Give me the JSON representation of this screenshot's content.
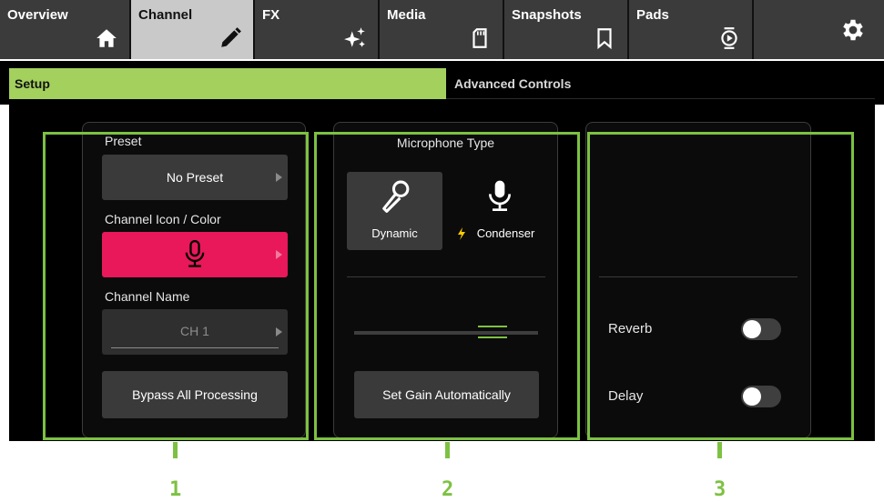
{
  "nav": {
    "tabs": [
      {
        "label": "Overview",
        "icon": "home-icon"
      },
      {
        "label": "Channel",
        "icon": "pencil-icon"
      },
      {
        "label": "FX",
        "icon": "sparkle-icon"
      },
      {
        "label": "Media",
        "icon": "sd-card-icon"
      },
      {
        "label": "Snapshots",
        "icon": "bookmark-icon"
      },
      {
        "label": "Pads",
        "icon": "pads-icon"
      }
    ],
    "active_tab": "Channel",
    "settings_icon": "gear-icon"
  },
  "subtabs": {
    "setup": "Setup",
    "advanced": "Advanced Controls",
    "active": "Setup"
  },
  "setup_panel": {
    "preset_label": "Preset",
    "preset_value": "No Preset",
    "icon_color_label": "Channel Icon / Color",
    "icon_color_value_icon": "microphone-icon",
    "icon_color_value_color": "#e8185a",
    "channel_name_label": "Channel Name",
    "channel_name_value": "CH 1",
    "bypass_label": "Bypass All Processing"
  },
  "mic_panel": {
    "title": "Microphone Type",
    "options": [
      {
        "label": "Dynamic",
        "icon": "dynamic-mic-icon",
        "selected": true
      },
      {
        "label": "Condenser",
        "icon": "condenser-mic-icon",
        "prefix_icon": "lightning-icon",
        "selected": false
      }
    ],
    "auto_gain_label": "Set Gain Automatically"
  },
  "effects_panel": {
    "toggles": [
      {
        "label": "Reverb",
        "on": false
      },
      {
        "label": "Delay",
        "on": false
      }
    ]
  },
  "annotations": [
    "1",
    "2",
    "3"
  ],
  "colors": {
    "accent_green": "#a4d05e",
    "highlight_green": "#7dc142",
    "channel_color": "#e8185a"
  }
}
